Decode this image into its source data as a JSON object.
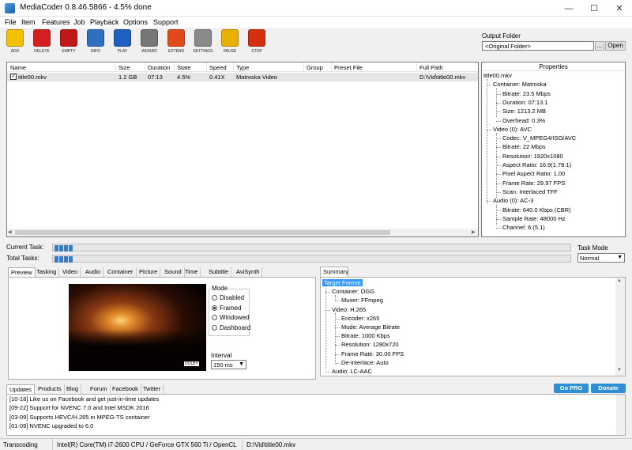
{
  "window": {
    "title": "MediaCoder 0.8.46.5866  -  4.5% done"
  },
  "menu": [
    "File",
    "Item",
    "Features",
    "Job",
    "Playback",
    "Options",
    "Support"
  ],
  "toolbar": [
    {
      "label": "ADD",
      "icon": "add-icon",
      "color": "#f2c200"
    },
    {
      "label": "DELETE",
      "icon": "delete-icon",
      "color": "#d42020"
    },
    {
      "label": "EMPTY",
      "icon": "empty-icon",
      "color": "#c01818"
    },
    {
      "label": "INFO",
      "icon": "info-icon",
      "color": "#2f6fc2"
    },
    {
      "label": "PLAY",
      "icon": "play-icon",
      "color": "#1f5fbf"
    },
    {
      "label": "WIZARD",
      "icon": "wizard-icon",
      "color": "#777777"
    },
    {
      "label": "EXTEND",
      "icon": "extend-icon",
      "color": "#e04a1a"
    },
    {
      "label": "SETTINGS",
      "icon": "settings-icon",
      "color": "#8a8a8a"
    },
    {
      "label": "PAUSE",
      "icon": "pause-icon",
      "color": "#e8b000"
    },
    {
      "label": "STOP",
      "icon": "stop-icon",
      "color": "#d43010"
    }
  ],
  "output_folder": {
    "label": "Output Folder",
    "value": "<Original Folder>",
    "browse": "...",
    "open": "Open"
  },
  "file_list": {
    "columns": [
      "Name",
      "Size",
      "Duration",
      "State",
      "Speed",
      "Type",
      "Group",
      "Preset File",
      "Full Path"
    ],
    "rows": [
      {
        "checked": true,
        "name": "title00.mkv",
        "size": "1.2 GB",
        "duration": "07:13",
        "state": "4.5%",
        "speed": "0.41X",
        "type": "Matroska Video",
        "group": "",
        "preset": "",
        "path": "D:\\Vid\\title00.mkv"
      }
    ]
  },
  "properties": {
    "header": "Properties",
    "lines": [
      "title00.mkv",
      "Container: Matroska",
      "Bitrate: 23.5 Mbps",
      "Duration: 07:13.1",
      "Size: 1213.2 MB",
      "Overhead: 0.3%",
      "Video (0): AVC",
      "Codec: V_MPEG4/ISO/AVC",
      "Bitrate: 22 Mbps",
      "Resolution: 1920x1080",
      "Aspect Ratio: 16:9(1.78:1)",
      "Pixel Aspect Ratio: 1.00",
      "Frame Rate: 29.97 FPS",
      "Scan: Interlaced TFF",
      "Audio (0): AC-3",
      "Bitrate: 640.0 Kbps (CBR)",
      "Sample Rate: 48000 Hz",
      "Channel: 6 (5.1)"
    ]
  },
  "progress": {
    "current_label": "Current Task:",
    "current_value": 0.045,
    "total_label": "Total Tasks:",
    "total_value": 0.045,
    "task_mode_label": "Task Mode",
    "task_mode_value": "Normal"
  },
  "settings_tabs": [
    "Preview",
    "Tasking",
    "Video",
    "Audio",
    "Container",
    "Picture",
    "Sound",
    "Time",
    "Subtitle",
    "AviSynth"
  ],
  "preview": {
    "video_badge": "DOLBY",
    "mode_label": "Mode",
    "modes": [
      "Disabled",
      "Framed",
      "Windowed",
      "Dashboard"
    ],
    "selected_mode": "Framed",
    "interval_label": "Interval",
    "interval_value": "150 ms"
  },
  "summary": {
    "tab": "Summary",
    "lines": [
      "Target Format",
      "Container: OGG",
      "Muxer: FFmpeg",
      "Video: H.265",
      "Encoder: x265",
      "Mode: Average Bitrate",
      "Bitrate: 1000 Kbps",
      "Resolution: 1280x720",
      "Frame Rate: 30.00 FPS",
      "De-interlace: Auto",
      "Audio: LC-AAC"
    ]
  },
  "news_tabs": [
    "Updates",
    "Products",
    "Blog",
    "Forum",
    "Facebook",
    "Twitter"
  ],
  "badges": {
    "gopro": "Go PRO",
    "donate": "Donate"
  },
  "news": [
    "[10-18] Like us on Facebook and get just-in-time updates",
    "[09-22] Support for NVENC 7.0 and Intel MSDK 2016",
    "[03-09] Supports HEVC/H.265 in MPEG-TS container",
    "[01-09] NVENC upgraded to 6.0"
  ],
  "status": {
    "state": "Transcoding",
    "hardware": "Intel(R) Core(TM) i7-2600 CPU  /  GeForce GTX 560 Ti / OpenCL",
    "file": "D:\\Vid\\title00.mkv"
  }
}
